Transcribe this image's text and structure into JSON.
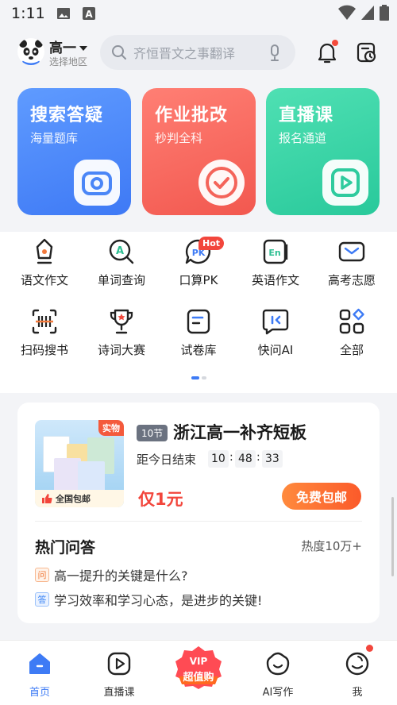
{
  "status_bar": {
    "time": "1:11"
  },
  "header": {
    "grade": "高一",
    "region": "选择地区",
    "search_placeholder": "齐恒晋文之事翻译"
  },
  "feature_cards": [
    {
      "title": "搜索答疑",
      "subtitle": "海量题库",
      "icon": "camera-icon"
    },
    {
      "title": "作业批改",
      "subtitle": "秒判全科",
      "icon": "check-icon"
    },
    {
      "title": "直播课",
      "subtitle": "报名通道",
      "icon": "play-icon"
    }
  ],
  "tools": [
    {
      "label": "语文作文",
      "icon": "pen-icon"
    },
    {
      "label": "单词查询",
      "icon": "word-search-icon"
    },
    {
      "label": "口算PK",
      "icon": "pk-icon"
    },
    {
      "label": "英语作文",
      "icon": "english-icon"
    },
    {
      "label": "高考志愿",
      "icon": "mail-icon"
    },
    {
      "label": "扫码搜书",
      "icon": "barcode-icon"
    },
    {
      "label": "诗词大赛",
      "icon": "trophy-icon"
    },
    {
      "label": "试卷库",
      "icon": "paper-icon"
    },
    {
      "label": "快问AI",
      "icon": "ai-chat-icon"
    },
    {
      "label": "全部",
      "icon": "grid-icon"
    }
  ],
  "hot_badge": "Hot",
  "promo": {
    "tag_shiwu": "实物",
    "baoyou": "全国包邮",
    "lessons": "10节",
    "title": "浙江高一补齐短板",
    "countdown_label": "距今日结束",
    "hours": "10",
    "minutes": "48",
    "seconds": "33",
    "price": "仅1元",
    "button": "免费包邮"
  },
  "qa": {
    "title": "热门问答",
    "heat": "热度10万+",
    "q_tag": "问",
    "question": "高一提升的关键是什么?",
    "a_tag": "答",
    "answer": "学习效率和学习心态，是进步的关键!"
  },
  "bottom_nav": {
    "items": [
      {
        "label": "首页",
        "icon": "home-icon",
        "active": true
      },
      {
        "label": "直播课",
        "icon": "live-icon",
        "active": false
      },
      {
        "label": "AI写作",
        "icon": "ai-write-icon",
        "active": false
      },
      {
        "label": "我",
        "icon": "me-icon",
        "active": false
      }
    ],
    "vip_top": "VIP",
    "vip_bottom": "超值购"
  },
  "colors": {
    "accent": "#3e7bf5",
    "card_blue": "#4a86f7",
    "card_red": "#f66a60",
    "card_green": "#37d3a5",
    "price_red": "#f2463c",
    "button_orange": "#fb6a2f"
  }
}
